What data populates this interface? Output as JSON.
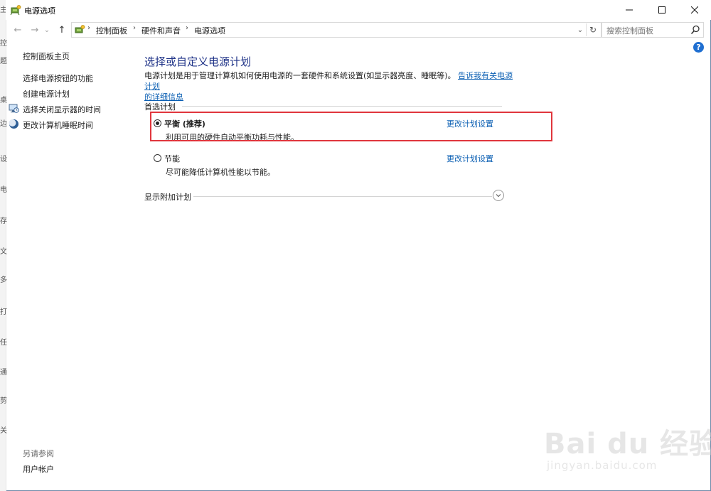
{
  "window": {
    "title": "电源选项",
    "minimize_glyph": "—",
    "maximize_glyph": "☐",
    "close_glyph": "✕"
  },
  "navigation": {
    "back_glyph": "←",
    "forward_glyph": "→",
    "recent_glyph": "⌄",
    "up_glyph": "↑"
  },
  "address_bar": {
    "breadcrumbs": [
      "控制面板",
      "硬件和声音",
      "电源选项"
    ],
    "separator": "›",
    "dropdown_glyph": "⌄",
    "refresh_glyph": "↻"
  },
  "search": {
    "placeholder": "搜索控制面板"
  },
  "help": {
    "glyph": "?"
  },
  "sidebar": {
    "home": "控制面板主页",
    "items": [
      {
        "label": "选择电源按钮的功能",
        "icon": ""
      },
      {
        "label": "创建电源计划",
        "icon": ""
      },
      {
        "label": "选择关闭显示器的时间",
        "icon": "monitor-clock-icon"
      },
      {
        "label": "更改计算机睡眠时间",
        "icon": "moon-icon"
      }
    ],
    "see_also": "另请参阅",
    "user_accounts": "用户帐户"
  },
  "main": {
    "heading": "选择或自定义电源计划",
    "description": "电源计划是用于管理计算机如何使用电源的一套硬件和系统设置(如显示器亮度、睡眠等)。",
    "description_link_1": "告诉我有关电源计划",
    "description_link_2": "的详细信息",
    "preferred_group": "首选计划",
    "plans": [
      {
        "name": "平衡 (推荐)",
        "description": "利用可用的硬件自动平衡功耗与性能。",
        "selected": true,
        "link": "更改计划设置"
      },
      {
        "name": "节能",
        "description": "尽可能降低计算机性能以节能。",
        "selected": false,
        "link": "更改计划设置"
      }
    ],
    "show_additional": "显示附加计划"
  },
  "left_edge_chars": [
    "主",
    "控",
    "题",
    "桌",
    "边",
    "设",
    "电",
    "存",
    "文",
    "多",
    "打",
    "任",
    "通",
    "剪",
    "关"
  ],
  "colors": {
    "heading": "#1e3287",
    "link": "#0b5fb3",
    "highlight_border": "#e0363d",
    "help_icon": "#1f6fd1"
  },
  "watermark": {
    "brand": "Bai  du 经验",
    "url": "jingyan.baidu.com"
  }
}
